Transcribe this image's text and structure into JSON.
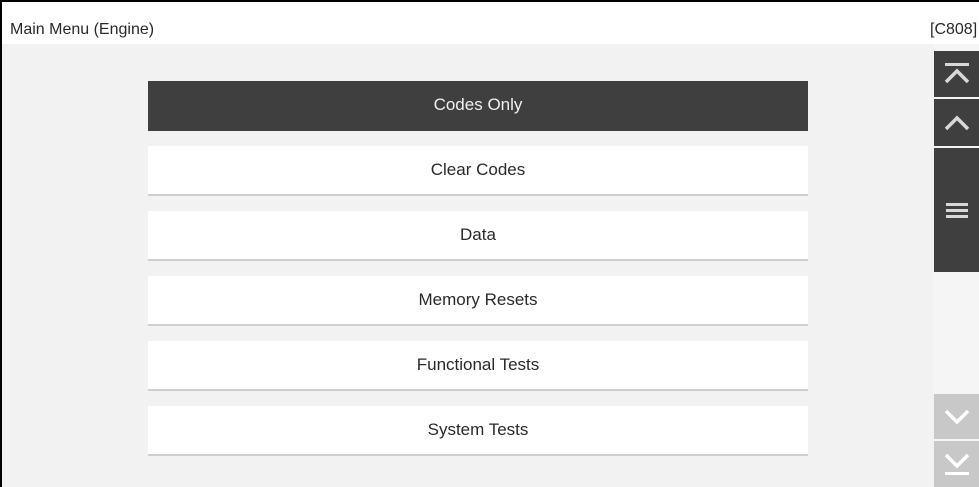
{
  "header": {
    "title": "Main Menu (Engine)",
    "screen_code": "[C808]"
  },
  "menu": {
    "selected_index": 0,
    "items": [
      {
        "label": "Codes Only"
      },
      {
        "label": "Clear Codes"
      },
      {
        "label": "Data"
      },
      {
        "label": "Memory Resets"
      },
      {
        "label": "Functional Tests"
      },
      {
        "label": "System Tests"
      }
    ]
  },
  "scrollbar": {
    "buttons": {
      "top": "scroll-to-top-icon",
      "up": "chevron-up-icon",
      "down": "chevron-down-icon",
      "bottom": "scroll-to-bottom-icon"
    },
    "thumb_icon": "drag-handle-icon"
  },
  "colors": {
    "selected_bg": "#3f3f3f",
    "item_bg": "#ffffff",
    "content_bg": "#f2f2f2",
    "scroll_button_bg": "#3f3f3f",
    "scroll_button_light_bg": "#c8c8c8"
  }
}
